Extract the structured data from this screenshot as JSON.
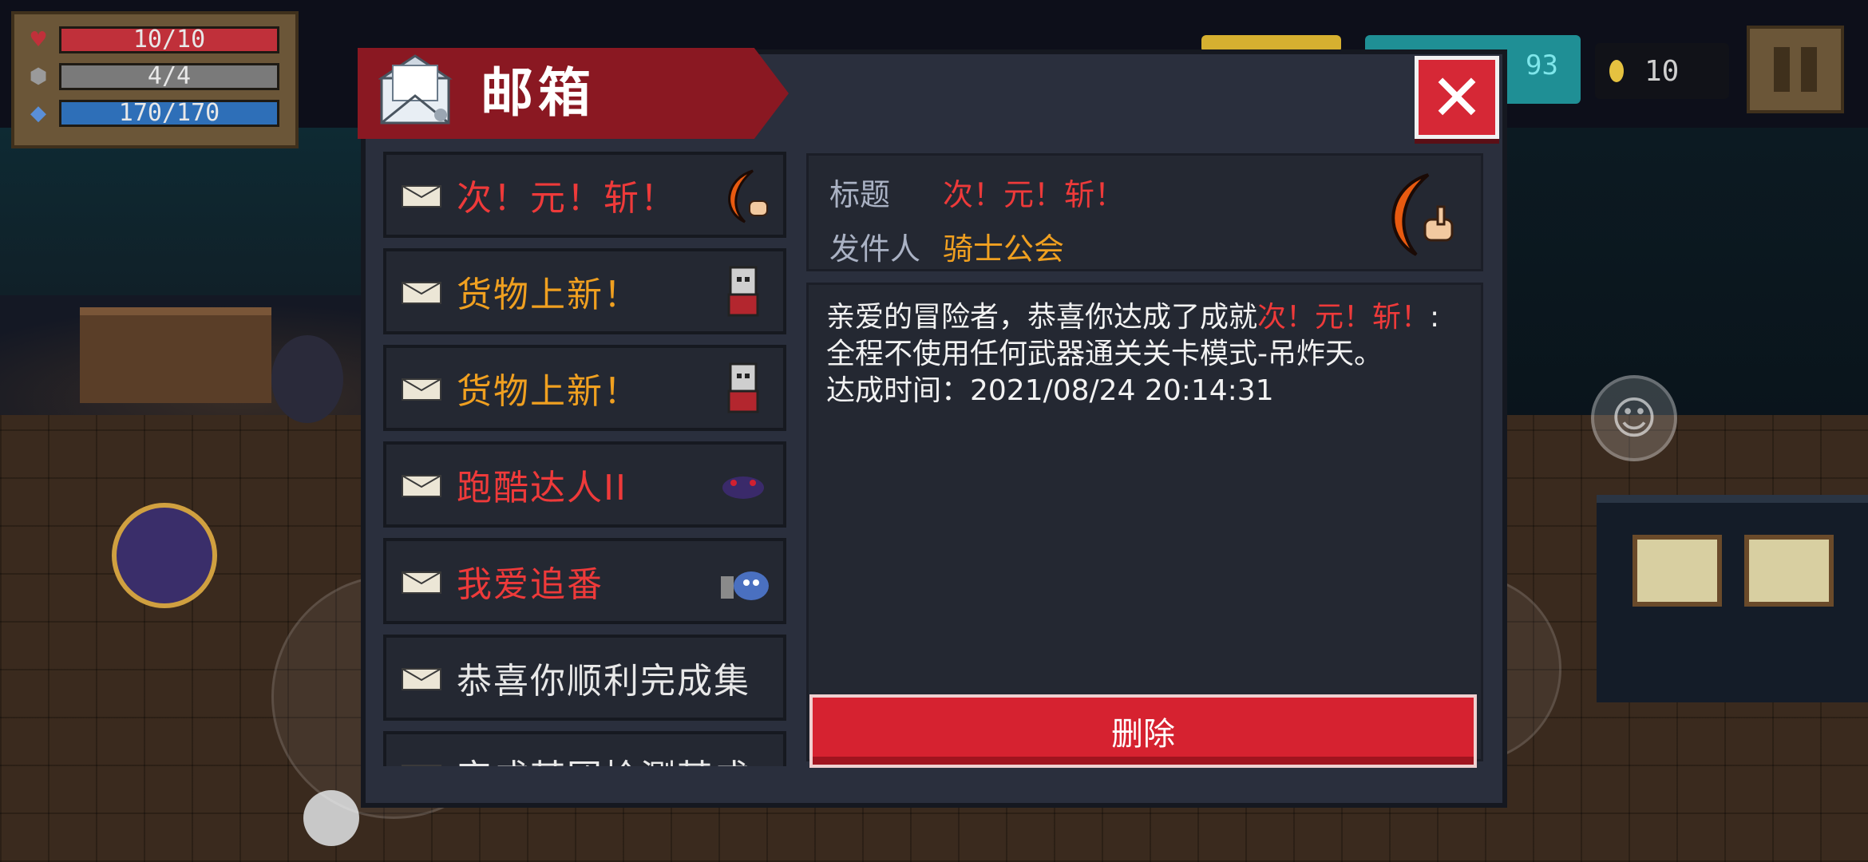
{
  "hud": {
    "hp": {
      "text": "10/10",
      "fraction": 1.0,
      "color": "#c0303a",
      "icon": "heart-icon"
    },
    "armor": {
      "text": "4/4",
      "fraction": 1.0,
      "color": "#7a7a7a",
      "icon": "shield-icon"
    },
    "energy": {
      "text": "170/170",
      "fraction": 1.0,
      "color": "#2e6fb8",
      "icon": "energy-crystal-icon"
    }
  },
  "top": {
    "gem_count_partial": "93",
    "coins": "10"
  },
  "mailbox": {
    "title": "邮箱",
    "close_icon": "close-x-icon",
    "items": [
      {
        "label": "次！元！斩！",
        "color": "#ee3a3a",
        "thumb": "crescent-blade-icon"
      },
      {
        "label": "货物上新！",
        "color": "#f0a020",
        "thumb": "merchant-icon"
      },
      {
        "label": "货物上新！",
        "color": "#f0a020",
        "thumb": "merchant-icon"
      },
      {
        "label": "跑酷达人II",
        "color": "#ee3a3a",
        "thumb": "shadow-runner-icon"
      },
      {
        "label": "我爱追番",
        "color": "#ee3a3a",
        "thumb": "tv-icon"
      },
      {
        "label": "恭喜你顺利完成集",
        "color": "#e8e8e8",
        "thumb": ""
      },
      {
        "label": "完成某团检测某成",
        "color": "#e8e8e8",
        "thumb": ""
      }
    ],
    "detail": {
      "title_label": "标题",
      "title_value": "次！元！斩！",
      "sender_label": "发件人",
      "sender_value": "骑士公会",
      "body_prefix": "亲爱的冒险者，恭喜你达成了成就",
      "body_achievement": "次！元！斩！",
      "body_suffix": ":全程不使用任何武器通关关卡模式-吊炸天。",
      "time_line": "达成时间：2021/08/24 20:14:31"
    },
    "delete_label": "删除"
  }
}
